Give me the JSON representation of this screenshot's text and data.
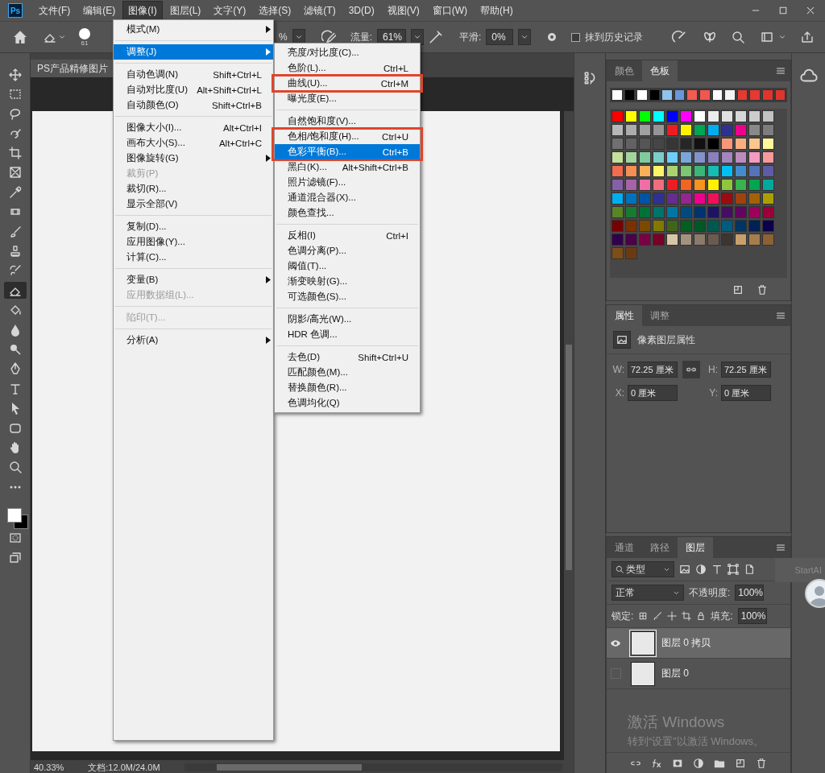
{
  "menubar": {
    "logo": "Ps",
    "items": [
      {
        "label": "文件(F)",
        "selected": false
      },
      {
        "label": "编辑(E)",
        "selected": false
      },
      {
        "label": "图像(I)",
        "selected": true
      },
      {
        "label": "图层(L)",
        "selected": false
      },
      {
        "label": "文字(Y)",
        "selected": false
      },
      {
        "label": "选择(S)",
        "selected": false
      },
      {
        "label": "滤镜(T)",
        "selected": false
      },
      {
        "label": "3D(D)",
        "selected": false
      },
      {
        "label": "视图(V)",
        "selected": false
      },
      {
        "label": "窗口(W)",
        "selected": false
      },
      {
        "label": "帮助(H)",
        "selected": false
      }
    ]
  },
  "options_bar": {
    "brush_size": "61",
    "partial_value": "%",
    "flow_label": "流量:",
    "flow_value": "61%",
    "smoothing_label": "平滑:",
    "smoothing_value": "0%",
    "erase_to_history": {
      "label": "抹到历史记录",
      "checked": false
    }
  },
  "toolbar": {
    "tools": [
      {
        "kind": "move",
        "selected": false
      },
      {
        "kind": "marquee",
        "selected": false
      },
      {
        "kind": "lasso",
        "selected": false
      },
      {
        "kind": "quick-select",
        "selected": false
      },
      {
        "kind": "crop",
        "selected": false
      },
      {
        "kind": "frame",
        "selected": false
      },
      {
        "kind": "eyedropper",
        "selected": false
      },
      {
        "kind": "patch",
        "selected": false
      },
      {
        "kind": "brush",
        "selected": false
      },
      {
        "kind": "stamp",
        "selected": false
      },
      {
        "kind": "history-brush",
        "selected": false
      },
      {
        "kind": "eraser",
        "selected": true
      },
      {
        "kind": "bucket",
        "selected": false
      },
      {
        "kind": "blur",
        "selected": false
      },
      {
        "kind": "dodge",
        "selected": false
      },
      {
        "kind": "pen",
        "selected": false
      },
      {
        "kind": "type",
        "selected": false
      },
      {
        "kind": "path-select",
        "selected": false
      },
      {
        "kind": "rectangle",
        "selected": false
      },
      {
        "kind": "hand",
        "selected": false
      },
      {
        "kind": "zoom",
        "selected": false
      },
      {
        "kind": "more",
        "selected": false
      }
    ]
  },
  "document": {
    "tab_title": "PS产品精修图片",
    "zoom": "40.33%",
    "doc_info": "文档:12.0M/24.0M"
  },
  "image_menu": {
    "sections": [
      [
        {
          "label": "模式(M)",
          "submenu": true,
          "disabled": false,
          "selected": false
        }
      ],
      [
        {
          "label": "调整(J)",
          "submenu": true,
          "disabled": false,
          "selected": true
        }
      ],
      [
        {
          "label": "自动色调(N)",
          "shortcut": "Shift+Ctrl+L",
          "submenu": false,
          "disabled": false,
          "selected": false
        },
        {
          "label": "自动对比度(U)",
          "shortcut": "Alt+Shift+Ctrl+L",
          "submenu": false,
          "disabled": false,
          "selected": false
        },
        {
          "label": "自动颜色(O)",
          "shortcut": "Shift+Ctrl+B",
          "submenu": false,
          "disabled": false,
          "selected": false
        }
      ],
      [
        {
          "label": "图像大小(I)...",
          "shortcut": "Alt+Ctrl+I",
          "submenu": false,
          "disabled": false,
          "selected": false
        },
        {
          "label": "画布大小(S)...",
          "shortcut": "Alt+Ctrl+C",
          "submenu": false,
          "disabled": false,
          "selected": false
        },
        {
          "label": "图像旋转(G)",
          "submenu": true,
          "disabled": false,
          "selected": false
        },
        {
          "label": "裁剪(P)",
          "submenu": false,
          "disabled": true,
          "selected": false
        },
        {
          "label": "裁切(R)...",
          "submenu": false,
          "disabled": false,
          "selected": false
        },
        {
          "label": "显示全部(V)",
          "submenu": false,
          "disabled": false,
          "selected": false
        }
      ],
      [
        {
          "label": "复制(D)...",
          "submenu": false,
          "disabled": false,
          "selected": false
        },
        {
          "label": "应用图像(Y)...",
          "submenu": false,
          "disabled": false,
          "selected": false
        },
        {
          "label": "计算(C)...",
          "submenu": false,
          "disabled": false,
          "selected": false
        }
      ],
      [
        {
          "label": "变量(B)",
          "submenu": true,
          "disabled": false,
          "selected": false
        },
        {
          "label": "应用数据组(L)...",
          "submenu": false,
          "disabled": true,
          "selected": false
        }
      ],
      [
        {
          "label": "陷印(T)...",
          "submenu": false,
          "disabled": true,
          "selected": false
        }
      ],
      [
        {
          "label": "分析(A)",
          "submenu": true,
          "disabled": false,
          "selected": false
        }
      ]
    ]
  },
  "adjust_submenu": {
    "sections": [
      [
        {
          "boxed": false,
          "items": [
            {
              "label": "亮度/对比度(C)...",
              "selected": false
            },
            {
              "label": "色阶(L)...",
              "shortcut": "Ctrl+L",
              "selected": false
            }
          ]
        },
        {
          "boxed": true,
          "items": [
            {
              "label": "曲线(U)...",
              "shortcut": "Ctrl+M",
              "selected": false
            }
          ]
        },
        {
          "boxed": false,
          "items": [
            {
              "label": "曝光度(E)...",
              "selected": false
            }
          ]
        }
      ],
      [
        {
          "boxed": false,
          "items": [
            {
              "label": "自然饱和度(V)...",
              "selected": false
            }
          ]
        },
        {
          "boxed": true,
          "items": [
            {
              "label": "色相/饱和度(H)...",
              "shortcut": "Ctrl+U",
              "selected": false
            },
            {
              "label": "色彩平衡(B)...",
              "shortcut": "Ctrl+B",
              "selected": true
            }
          ]
        },
        {
          "boxed": false,
          "items": [
            {
              "label": "黑白(K)...",
              "shortcut": "Alt+Shift+Ctrl+B",
              "selected": false
            },
            {
              "label": "照片滤镜(F)...",
              "selected": false
            },
            {
              "label": "通道混合器(X)...",
              "selected": false
            },
            {
              "label": "颜色查找...",
              "selected": false
            }
          ]
        }
      ],
      [
        {
          "boxed": false,
          "items": [
            {
              "label": "反相(I)",
              "shortcut": "Ctrl+I",
              "selected": false
            },
            {
              "label": "色调分离(P)...",
              "selected": false
            },
            {
              "label": "阈值(T)...",
              "selected": false
            },
            {
              "label": "渐变映射(G)...",
              "selected": false
            },
            {
              "label": "可选颜色(S)...",
              "selected": false
            }
          ]
        }
      ],
      [
        {
          "boxed": false,
          "items": [
            {
              "label": "阴影/高光(W)...",
              "selected": false
            },
            {
              "label": "HDR 色调...",
              "selected": false
            }
          ]
        }
      ],
      [
        {
          "boxed": false,
          "items": [
            {
              "label": "去色(D)",
              "shortcut": "Shift+Ctrl+U",
              "selected": false
            },
            {
              "label": "匹配颜色(M)...",
              "selected": false
            },
            {
              "label": "替换颜色(R)...",
              "selected": false
            },
            {
              "label": "色调均化(Q)",
              "selected": false
            }
          ]
        }
      ]
    ]
  },
  "swatches_panel": {
    "tabs": [
      {
        "label": "颜色",
        "selected": false
      },
      {
        "label": "色板",
        "selected": true
      }
    ],
    "recent": [
      {
        "color": "#ffffff"
      },
      {
        "color": "#000000"
      },
      {
        "color": "#ffffff"
      },
      {
        "color": "#000000"
      },
      {
        "color": "#8fc4ee"
      },
      {
        "color": "#6a96dc"
      },
      {
        "color": "#f25c52"
      },
      {
        "color": "#f0584f"
      },
      {
        "color": "#ffffff"
      },
      {
        "color": "#f4f4f4"
      },
      {
        "color": "#e53a31"
      },
      {
        "color": "#e53a31"
      },
      {
        "color": "#e0352c"
      },
      {
        "color": "#e0352c"
      }
    ],
    "grid": [
      {
        "color": "#ff0000"
      },
      {
        "color": "#ffff00"
      },
      {
        "color": "#00ff00"
      },
      {
        "color": "#00ffff"
      },
      {
        "color": "#0000ff"
      },
      {
        "color": "#ff00ff"
      },
      {
        "color": "#ffffff"
      },
      {
        "color": "#ebebeb"
      },
      {
        "color": "#e1e1e1"
      },
      {
        "color": "#d7d7d7"
      },
      {
        "color": "#cccccc"
      },
      {
        "color": "#c2c2c2"
      },
      {
        "color": "#b7b7b7"
      },
      {
        "color": "#acacac"
      },
      {
        "color": "#a0a0a0"
      },
      {
        "color": "#959595"
      },
      {
        "color": "#ed1c24"
      },
      {
        "color": "#fff200"
      },
      {
        "color": "#00a651"
      },
      {
        "color": "#00aeef"
      },
      {
        "color": "#2e3192"
      },
      {
        "color": "#ec008c"
      },
      {
        "color": "#898989"
      },
      {
        "color": "#7d7d7d"
      },
      {
        "color": "#707070"
      },
      {
        "color": "#626262"
      },
      {
        "color": "#555555"
      },
      {
        "color": "#464646"
      },
      {
        "color": "#363636"
      },
      {
        "color": "#262626"
      },
      {
        "color": "#111111"
      },
      {
        "color": "#000000"
      },
      {
        "color": "#f7977a"
      },
      {
        "color": "#fbad82"
      },
      {
        "color": "#fdc68c"
      },
      {
        "color": "#fff799"
      },
      {
        "color": "#c6df9c"
      },
      {
        "color": "#a4d49d"
      },
      {
        "color": "#81ca9d"
      },
      {
        "color": "#7bcdc9"
      },
      {
        "color": "#6ccff7"
      },
      {
        "color": "#7ca6d8"
      },
      {
        "color": "#8293ca"
      },
      {
        "color": "#8881be"
      },
      {
        "color": "#a286bd"
      },
      {
        "color": "#bc8cbf"
      },
      {
        "color": "#f49bc1"
      },
      {
        "color": "#f5999d"
      },
      {
        "color": "#f26c4f"
      },
      {
        "color": "#f68e55"
      },
      {
        "color": "#fbaf5a"
      },
      {
        "color": "#fff467"
      },
      {
        "color": "#acd372"
      },
      {
        "color": "#7dc473"
      },
      {
        "color": "#39b778"
      },
      {
        "color": "#16bcb4"
      },
      {
        "color": "#00bff3"
      },
      {
        "color": "#438ccb"
      },
      {
        "color": "#5573b7"
      },
      {
        "color": "#5e5ca7"
      },
      {
        "color": "#855fa8"
      },
      {
        "color": "#a763a9"
      },
      {
        "color": "#ef6ea8"
      },
      {
        "color": "#f16d7e"
      },
      {
        "color": "#ee1d24"
      },
      {
        "color": "#f16522"
      },
      {
        "color": "#f7941d"
      },
      {
        "color": "#fff100"
      },
      {
        "color": "#8fc63d"
      },
      {
        "color": "#37b44a"
      },
      {
        "color": "#00a650"
      },
      {
        "color": "#00a99e"
      },
      {
        "color": "#00aeef"
      },
      {
        "color": "#0072bc"
      },
      {
        "color": "#0054a5"
      },
      {
        "color": "#2f3192"
      },
      {
        "color": "#652c91"
      },
      {
        "color": "#91278f"
      },
      {
        "color": "#ed008c"
      },
      {
        "color": "#ee105a"
      },
      {
        "color": "#9d0a0f"
      },
      {
        "color": "#a1410d"
      },
      {
        "color": "#a36209"
      },
      {
        "color": "#aba000"
      },
      {
        "color": "#588528"
      },
      {
        "color": "#197b30"
      },
      {
        "color": "#007236"
      },
      {
        "color": "#00736a"
      },
      {
        "color": "#0076a4"
      },
      {
        "color": "#004a80"
      },
      {
        "color": "#003370"
      },
      {
        "color": "#1d1363"
      },
      {
        "color": "#450e61"
      },
      {
        "color": "#62055f"
      },
      {
        "color": "#9e005c"
      },
      {
        "color": "#9d0039"
      },
      {
        "color": "#790000"
      },
      {
        "color": "#7b3000"
      },
      {
        "color": "#7c4900"
      },
      {
        "color": "#827a00"
      },
      {
        "color": "#3e6617"
      },
      {
        "color": "#045f20"
      },
      {
        "color": "#005824"
      },
      {
        "color": "#005951"
      },
      {
        "color": "#005b7e"
      },
      {
        "color": "#003562"
      },
      {
        "color": "#002056"
      },
      {
        "color": "#0c004b"
      },
      {
        "color": "#30004a"
      },
      {
        "color": "#4b0048"
      },
      {
        "color": "#7a0045"
      },
      {
        "color": "#7a0026"
      },
      {
        "color": "#d8c6a6"
      },
      {
        "color": "#a39280"
      },
      {
        "color": "#8c7b6b"
      },
      {
        "color": "#6b5b4f"
      },
      {
        "color": "#3c3530"
      },
      {
        "color": "#c8a06c"
      },
      {
        "color": "#a57d4f"
      },
      {
        "color": "#8c6133"
      },
      {
        "color": "#7d4e1a"
      },
      {
        "color": "#6b3a10"
      }
    ]
  },
  "properties_panel": {
    "tabs": [
      {
        "label": "属性",
        "selected": true
      },
      {
        "label": "调整",
        "selected": false
      }
    ],
    "title": "像素图层属性",
    "w_label": "W:",
    "w": "72.25 厘米",
    "h_label": "H:",
    "h": "72.25 厘米",
    "x_label": "X:",
    "x": "0 厘米",
    "y_label": "Y:",
    "y": "0 厘米"
  },
  "layers_panel": {
    "tabs": [
      {
        "label": "通道",
        "selected": false
      },
      {
        "label": "路径",
        "selected": false
      },
      {
        "label": "图层",
        "selected": true
      }
    ],
    "filter": "类型",
    "blend_mode": "正常",
    "opacity_label": "不透明度:",
    "opacity": "100%",
    "lock_label": "锁定:",
    "fill_label": "填充:",
    "fill": "100%",
    "layers": [
      {
        "name": "图层 0 拷贝",
        "visible": true,
        "selected": true
      },
      {
        "name": "图层 0",
        "visible": false,
        "selected": false
      }
    ]
  },
  "startai": {
    "label": "StartAI"
  },
  "os_overlay": {
    "title": "激活 Windows",
    "subtitle": "转到“设置”以激活 Windows。"
  }
}
